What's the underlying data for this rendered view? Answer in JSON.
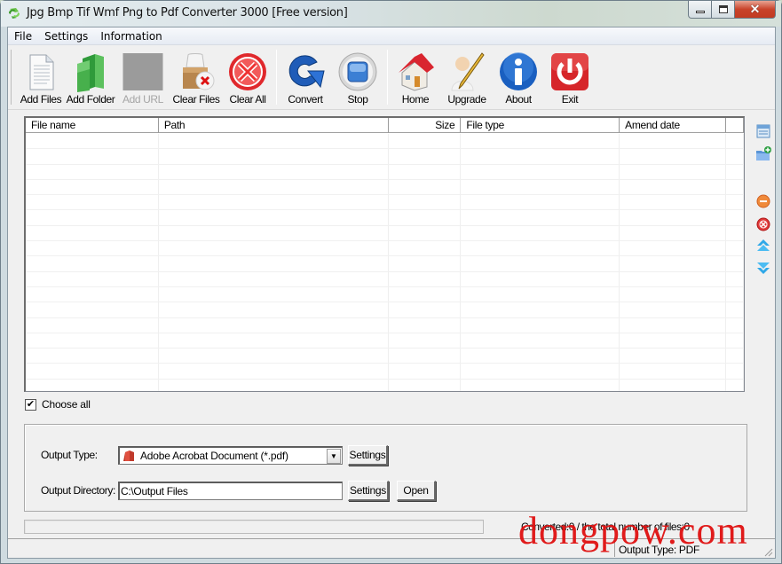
{
  "window": {
    "title": "Jpg Bmp Tif Wmf Png to Pdf Converter 3000 [Free version]",
    "controls": {
      "minimize": "minimize",
      "maximize": "maximize",
      "close": "close"
    }
  },
  "menu": {
    "items": [
      {
        "label": "File"
      },
      {
        "label": "Settings"
      },
      {
        "label": "Information"
      }
    ]
  },
  "toolbar": {
    "buttons": [
      {
        "id": "add-files",
        "label": "Add Files",
        "icon": "document-icon",
        "enabled": true
      },
      {
        "id": "add-folder",
        "label": "Add Folder",
        "icon": "green-folder-icon",
        "enabled": true
      },
      {
        "id": "add-url",
        "label": "Add URL",
        "icon": "url-placeholder-icon",
        "enabled": false
      },
      {
        "id": "clear-files",
        "label": "Clear Files",
        "icon": "box-clear-icon",
        "enabled": true
      },
      {
        "id": "clear-all",
        "label": "Clear All",
        "icon": "red-x-circle-icon",
        "enabled": true
      },
      {
        "id": "convert",
        "label": "Convert",
        "icon": "convert-arrow-icon",
        "enabled": true
      },
      {
        "id": "stop",
        "label": "Stop",
        "icon": "stop-square-icon",
        "enabled": true
      },
      {
        "id": "home",
        "label": "Home",
        "icon": "house-icon",
        "enabled": true
      },
      {
        "id": "upgrade",
        "label": "Upgrade",
        "icon": "user-pencil-icon",
        "enabled": true
      },
      {
        "id": "about",
        "label": "About",
        "icon": "info-icon",
        "enabled": true
      },
      {
        "id": "exit",
        "label": "Exit",
        "icon": "power-icon",
        "enabled": true
      }
    ]
  },
  "file_table": {
    "columns": [
      {
        "label": "File name"
      },
      {
        "label": "Path"
      },
      {
        "label": "Size"
      },
      {
        "label": "File type"
      },
      {
        "label": "Amend date"
      },
      {
        "label": ""
      }
    ],
    "rows": []
  },
  "side_icons": [
    {
      "name": "list-view-icon"
    },
    {
      "name": "add-folder-icon"
    },
    {
      "name": "remove-icon"
    },
    {
      "name": "delete-all-icon"
    },
    {
      "name": "move-up-icon"
    },
    {
      "name": "move-down-icon"
    }
  ],
  "choose_all": {
    "label": "Choose all",
    "checked": true
  },
  "output": {
    "type_label": "Output Type:",
    "type_value": "Adobe Acrobat Document (*.pdf)",
    "type_settings_label": "Settings",
    "dir_label": "Output Directory:",
    "dir_value": "C:\\Output Files",
    "dir_settings_label": "Settings",
    "open_label": "Open"
  },
  "progress": {
    "value": 0
  },
  "status": {
    "converted_text": "Converted:0  /  the total number of files:0",
    "output_type_text": "Output Type: PDF"
  },
  "watermark": {
    "text": "dongpow.com",
    "color": "#e01010"
  }
}
